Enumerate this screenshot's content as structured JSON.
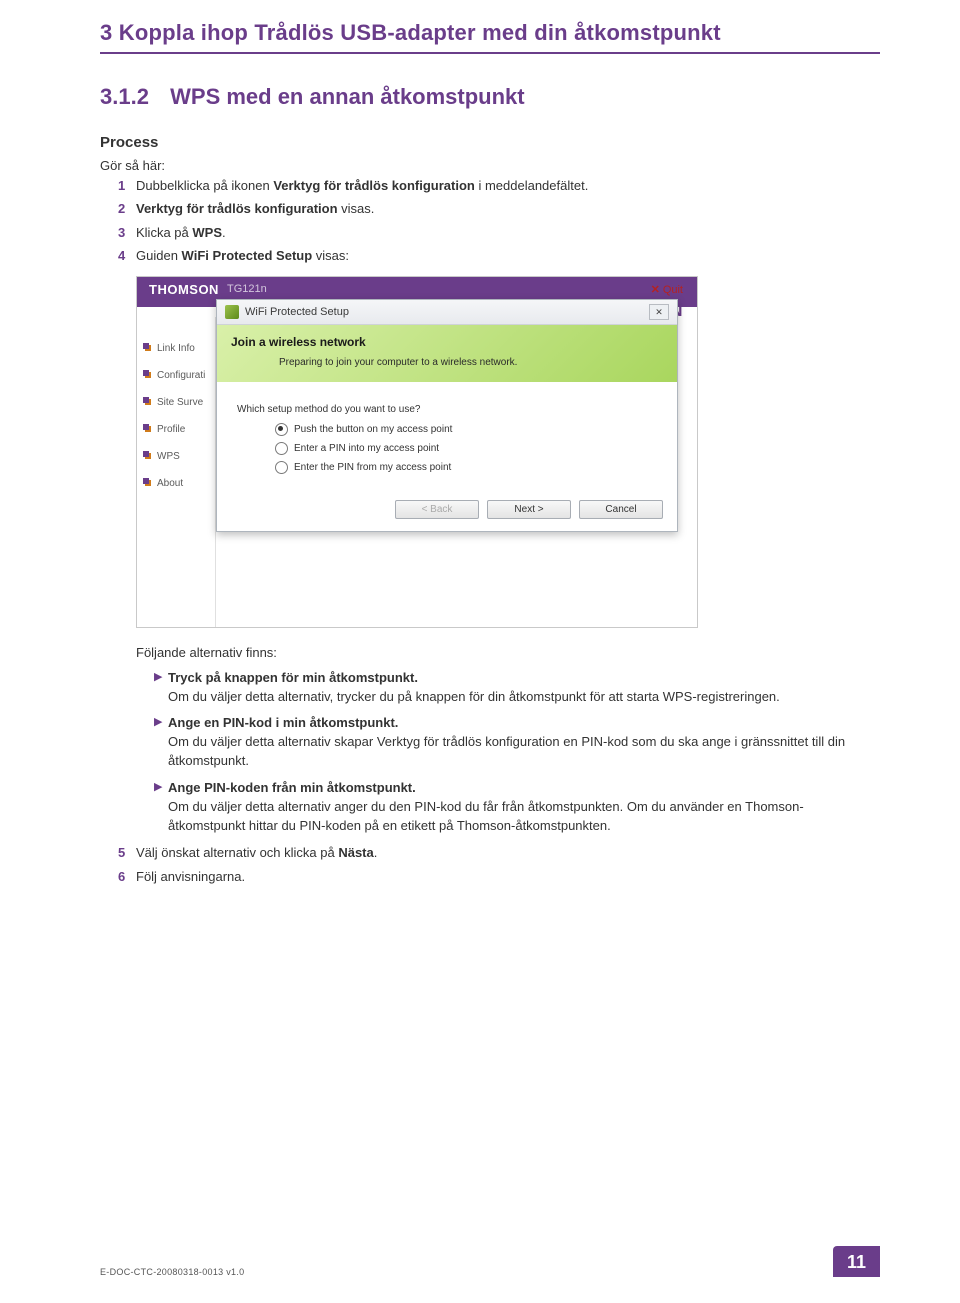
{
  "header": {
    "chapter_title": "3 Koppla ihop Trådlös USB-adapter med din åtkomstpunkt"
  },
  "section": {
    "num": "3.1.2",
    "title": "WPS med en annan åtkomstpunkt"
  },
  "process": {
    "heading": "Process",
    "intro": "Gör så här:",
    "steps": [
      {
        "n": "1",
        "text_pre": "Dubbelklicka på ikonen ",
        "bold1": "Verktyg för trådlös konfiguration",
        "text_mid": " i meddelandefältet."
      },
      {
        "n": "2",
        "text_pre": "",
        "bold1": "Verktyg för trådlös konfiguration",
        "text_mid": " visas."
      },
      {
        "n": "3",
        "text_pre": "Klicka på ",
        "bold1": "WPS",
        "text_mid": "."
      },
      {
        "n": "4",
        "text_pre": "Guiden ",
        "bold1": "WiFi Protected Setup",
        "text_mid": " visas:"
      }
    ],
    "alt_intro": "Följande alternativ finns:",
    "bullets": [
      {
        "bold": "Tryck på knappen för min åtkomstpunkt.",
        "text": "Om du väljer detta alternativ, trycker du på knappen för din åtkomstpunkt för att starta WPS-registreringen."
      },
      {
        "bold": "Ange en PIN-kod i min åtkomstpunkt.",
        "text": "Om du väljer detta alternativ skapar Verktyg för trådlös konfiguration en PIN-kod som du ska ange i gränssnittet till din åtkomstpunkt."
      },
      {
        "bold": "Ange PIN-koden från min åtkomstpunkt.",
        "text": "Om du väljer detta alternativ anger du den PIN-kod du får från åtkomstpunkten. Om du använder en Thomson-åtkomstpunkt hittar du PIN-koden på en etikett på Thomson-åtkomstpunkten."
      }
    ],
    "step5_pre": "Välj önskat alternativ och klicka på ",
    "step5_bold": "Nästa",
    "step5_post": ".",
    "step6": "Följ anvisningarna."
  },
  "screenshot": {
    "brand": "THOMSON",
    "device": "TG121n",
    "brandlogo": "SON",
    "quit": "Quit",
    "sidebar": [
      "Link Info",
      "Configurati",
      "Site Surve",
      "Profile",
      "WPS",
      "About"
    ],
    "dialog": {
      "title": "WiFi Protected Setup",
      "banner_title": "Join a wireless network",
      "banner_sub": "Preparing to join your computer to a wireless network.",
      "question": "Which setup method do you want to use?",
      "options": [
        {
          "label": "Push the button on my access point",
          "checked": true
        },
        {
          "label": "Enter a PIN into my access point",
          "checked": false
        },
        {
          "label": "Enter the PIN from my access point",
          "checked": false
        }
      ],
      "btn_back": "< Back",
      "btn_next": "Next >",
      "btn_cancel": "Cancel"
    }
  },
  "footer": {
    "doccode": "E-DOC-CTC-20080318-0013 v1.0",
    "pagenum": "11"
  }
}
